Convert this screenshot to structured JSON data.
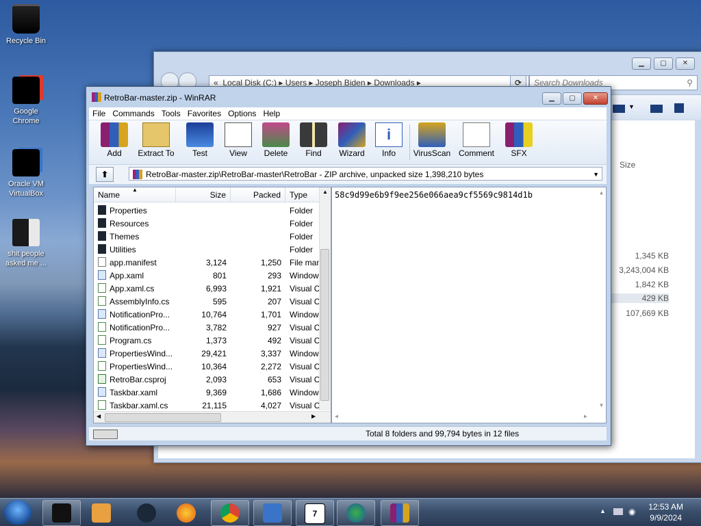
{
  "desktop_icons": [
    {
      "label": "Recycle Bin",
      "icon": "recycle-bin-icon"
    },
    {
      "label": "Google Chrome",
      "icon": "chrome-icon"
    },
    {
      "label": "Oracle VM VirtualBox",
      "icon": "virtualbox-icon"
    },
    {
      "label": "shit people asked me ...",
      "icon": "folder-icon"
    }
  ],
  "explorer": {
    "address": [
      "Local Disk (C:)",
      "Users",
      "Joseph Biden",
      "Downloads"
    ],
    "search_placeholder": "Search Downloads",
    "column_size": "Size",
    "sizes": [
      "1,345 KB",
      "3,243,004 KB",
      "1,842 KB",
      "429 KB",
      "107,669 KB"
    ]
  },
  "winrar": {
    "title": "RetroBar-master.zip - WinRAR",
    "menu": [
      "File",
      "Commands",
      "Tools",
      "Favorites",
      "Options",
      "Help"
    ],
    "toolbar": [
      "Add",
      "Extract To",
      "Test",
      "View",
      "Delete",
      "Find",
      "Wizard",
      "Info",
      "VirusScan",
      "Comment",
      "SFX"
    ],
    "path": "RetroBar-master.zip\\RetroBar-master\\RetroBar - ZIP archive, unpacked size 1,398,210 bytes",
    "columns": {
      "name": "Name",
      "size": "Size",
      "packed": "Packed",
      "type": "Type"
    },
    "files": [
      {
        "name": "Properties",
        "size": "",
        "packed": "",
        "type": "Folder",
        "icon": "folder"
      },
      {
        "name": "Resources",
        "size": "",
        "packed": "",
        "type": "Folder",
        "icon": "folder"
      },
      {
        "name": "Themes",
        "size": "",
        "packed": "",
        "type": "Folder",
        "icon": "folder"
      },
      {
        "name": "Utilities",
        "size": "",
        "packed": "",
        "type": "Folder",
        "icon": "folder"
      },
      {
        "name": "app.manifest",
        "size": "3,124",
        "packed": "1,250",
        "type": "File man",
        "icon": "file"
      },
      {
        "name": "App.xaml",
        "size": "801",
        "packed": "293",
        "type": "Window",
        "icon": "xaml"
      },
      {
        "name": "App.xaml.cs",
        "size": "6,993",
        "packed": "1,921",
        "type": "Visual C",
        "icon": "cs"
      },
      {
        "name": "AssemblyInfo.cs",
        "size": "595",
        "packed": "207",
        "type": "Visual C",
        "icon": "cs"
      },
      {
        "name": "NotificationPro...",
        "size": "10,764",
        "packed": "1,701",
        "type": "Window",
        "icon": "xaml"
      },
      {
        "name": "NotificationPro...",
        "size": "3,782",
        "packed": "927",
        "type": "Visual C",
        "icon": "cs"
      },
      {
        "name": "Program.cs",
        "size": "1,373",
        "packed": "492",
        "type": "Visual C",
        "icon": "cs"
      },
      {
        "name": "PropertiesWind...",
        "size": "29,421",
        "packed": "3,337",
        "type": "Window",
        "icon": "xaml"
      },
      {
        "name": "PropertiesWind...",
        "size": "10,364",
        "packed": "2,272",
        "type": "Visual C",
        "icon": "cs"
      },
      {
        "name": "RetroBar.csproj",
        "size": "2,093",
        "packed": "653",
        "type": "Visual C",
        "icon": "proj"
      },
      {
        "name": "Taskbar.xaml",
        "size": "9,369",
        "packed": "1,686",
        "type": "Window",
        "icon": "xaml"
      },
      {
        "name": "Taskbar.xaml.cs",
        "size": "21,115",
        "packed": "4,027",
        "type": "Visual C",
        "icon": "cs"
      }
    ],
    "comment": "58c9d99e6b9f9ee256e066aea9cf5569c9814d1b",
    "status": "Total 8 folders and 99,794 bytes in 12 files"
  },
  "taskbar": {
    "apps": [
      "terminal-icon",
      "media-player-icon",
      "steam-icon",
      "firefox-icon",
      "chrome-icon",
      "virtualbox-icon",
      "sevenzip-icon",
      "idm-icon",
      "winrar-icon"
    ],
    "time": "12:53 AM",
    "date": "9/9/2024"
  }
}
